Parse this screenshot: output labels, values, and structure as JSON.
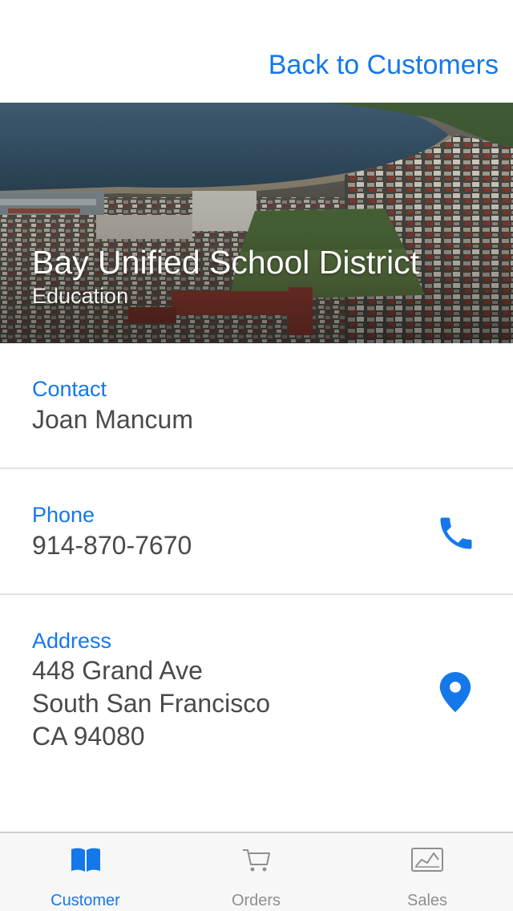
{
  "nav": {
    "back_label": "Back to Customers"
  },
  "hero": {
    "title": "Bay Unified School District",
    "subtitle": "Education"
  },
  "details": {
    "contact": {
      "label": "Contact",
      "value": "Joan Mancum"
    },
    "phone": {
      "label": "Phone",
      "value": "914-870-7670",
      "icon": "phone-icon"
    },
    "address": {
      "label": "Address",
      "lines": [
        "448 Grand Ave",
        "South San Francisco",
        "CA 94080"
      ],
      "icon": "map-pin-icon"
    }
  },
  "tabbar": {
    "tabs": [
      {
        "label": "Customer",
        "icon": "book-icon",
        "active": true
      },
      {
        "label": "Orders",
        "icon": "cart-icon",
        "active": false
      },
      {
        "label": "Sales",
        "icon": "chart-icon",
        "active": false
      }
    ]
  },
  "colors": {
    "accent": "#1478ea",
    "text": "#4a4a4a",
    "inactive_tab": "#8e8e93",
    "divider": "#e2e2e2"
  }
}
